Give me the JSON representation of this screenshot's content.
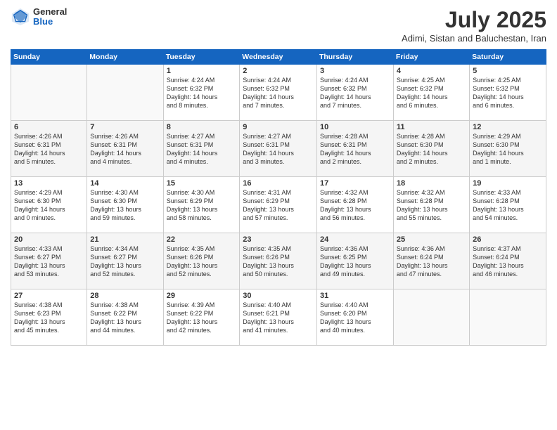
{
  "header": {
    "logo": {
      "line1": "General",
      "line2": "Blue"
    },
    "title": "July 2025",
    "subtitle": "Adimi, Sistan and Baluchestan, Iran"
  },
  "calendar": {
    "days_of_week": [
      "Sunday",
      "Monday",
      "Tuesday",
      "Wednesday",
      "Thursday",
      "Friday",
      "Saturday"
    ],
    "weeks": [
      [
        {
          "day": "",
          "info": ""
        },
        {
          "day": "",
          "info": ""
        },
        {
          "day": "1",
          "info": "Sunrise: 4:24 AM\nSunset: 6:32 PM\nDaylight: 14 hours\nand 8 minutes."
        },
        {
          "day": "2",
          "info": "Sunrise: 4:24 AM\nSunset: 6:32 PM\nDaylight: 14 hours\nand 7 minutes."
        },
        {
          "day": "3",
          "info": "Sunrise: 4:24 AM\nSunset: 6:32 PM\nDaylight: 14 hours\nand 7 minutes."
        },
        {
          "day": "4",
          "info": "Sunrise: 4:25 AM\nSunset: 6:32 PM\nDaylight: 14 hours\nand 6 minutes."
        },
        {
          "day": "5",
          "info": "Sunrise: 4:25 AM\nSunset: 6:32 PM\nDaylight: 14 hours\nand 6 minutes."
        }
      ],
      [
        {
          "day": "6",
          "info": "Sunrise: 4:26 AM\nSunset: 6:31 PM\nDaylight: 14 hours\nand 5 minutes."
        },
        {
          "day": "7",
          "info": "Sunrise: 4:26 AM\nSunset: 6:31 PM\nDaylight: 14 hours\nand 4 minutes."
        },
        {
          "day": "8",
          "info": "Sunrise: 4:27 AM\nSunset: 6:31 PM\nDaylight: 14 hours\nand 4 minutes."
        },
        {
          "day": "9",
          "info": "Sunrise: 4:27 AM\nSunset: 6:31 PM\nDaylight: 14 hours\nand 3 minutes."
        },
        {
          "day": "10",
          "info": "Sunrise: 4:28 AM\nSunset: 6:31 PM\nDaylight: 14 hours\nand 2 minutes."
        },
        {
          "day": "11",
          "info": "Sunrise: 4:28 AM\nSunset: 6:30 PM\nDaylight: 14 hours\nand 2 minutes."
        },
        {
          "day": "12",
          "info": "Sunrise: 4:29 AM\nSunset: 6:30 PM\nDaylight: 14 hours\nand 1 minute."
        }
      ],
      [
        {
          "day": "13",
          "info": "Sunrise: 4:29 AM\nSunset: 6:30 PM\nDaylight: 14 hours\nand 0 minutes."
        },
        {
          "day": "14",
          "info": "Sunrise: 4:30 AM\nSunset: 6:30 PM\nDaylight: 13 hours\nand 59 minutes."
        },
        {
          "day": "15",
          "info": "Sunrise: 4:30 AM\nSunset: 6:29 PM\nDaylight: 13 hours\nand 58 minutes."
        },
        {
          "day": "16",
          "info": "Sunrise: 4:31 AM\nSunset: 6:29 PM\nDaylight: 13 hours\nand 57 minutes."
        },
        {
          "day": "17",
          "info": "Sunrise: 4:32 AM\nSunset: 6:28 PM\nDaylight: 13 hours\nand 56 minutes."
        },
        {
          "day": "18",
          "info": "Sunrise: 4:32 AM\nSunset: 6:28 PM\nDaylight: 13 hours\nand 55 minutes."
        },
        {
          "day": "19",
          "info": "Sunrise: 4:33 AM\nSunset: 6:28 PM\nDaylight: 13 hours\nand 54 minutes."
        }
      ],
      [
        {
          "day": "20",
          "info": "Sunrise: 4:33 AM\nSunset: 6:27 PM\nDaylight: 13 hours\nand 53 minutes."
        },
        {
          "day": "21",
          "info": "Sunrise: 4:34 AM\nSunset: 6:27 PM\nDaylight: 13 hours\nand 52 minutes."
        },
        {
          "day": "22",
          "info": "Sunrise: 4:35 AM\nSunset: 6:26 PM\nDaylight: 13 hours\nand 52 minutes."
        },
        {
          "day": "23",
          "info": "Sunrise: 4:35 AM\nSunset: 6:26 PM\nDaylight: 13 hours\nand 50 minutes."
        },
        {
          "day": "24",
          "info": "Sunrise: 4:36 AM\nSunset: 6:25 PM\nDaylight: 13 hours\nand 49 minutes."
        },
        {
          "day": "25",
          "info": "Sunrise: 4:36 AM\nSunset: 6:24 PM\nDaylight: 13 hours\nand 47 minutes."
        },
        {
          "day": "26",
          "info": "Sunrise: 4:37 AM\nSunset: 6:24 PM\nDaylight: 13 hours\nand 46 minutes."
        }
      ],
      [
        {
          "day": "27",
          "info": "Sunrise: 4:38 AM\nSunset: 6:23 PM\nDaylight: 13 hours\nand 45 minutes."
        },
        {
          "day": "28",
          "info": "Sunrise: 4:38 AM\nSunset: 6:22 PM\nDaylight: 13 hours\nand 44 minutes."
        },
        {
          "day": "29",
          "info": "Sunrise: 4:39 AM\nSunset: 6:22 PM\nDaylight: 13 hours\nand 42 minutes."
        },
        {
          "day": "30",
          "info": "Sunrise: 4:40 AM\nSunset: 6:21 PM\nDaylight: 13 hours\nand 41 minutes."
        },
        {
          "day": "31",
          "info": "Sunrise: 4:40 AM\nSunset: 6:20 PM\nDaylight: 13 hours\nand 40 minutes."
        },
        {
          "day": "",
          "info": ""
        },
        {
          "day": "",
          "info": ""
        }
      ]
    ]
  }
}
